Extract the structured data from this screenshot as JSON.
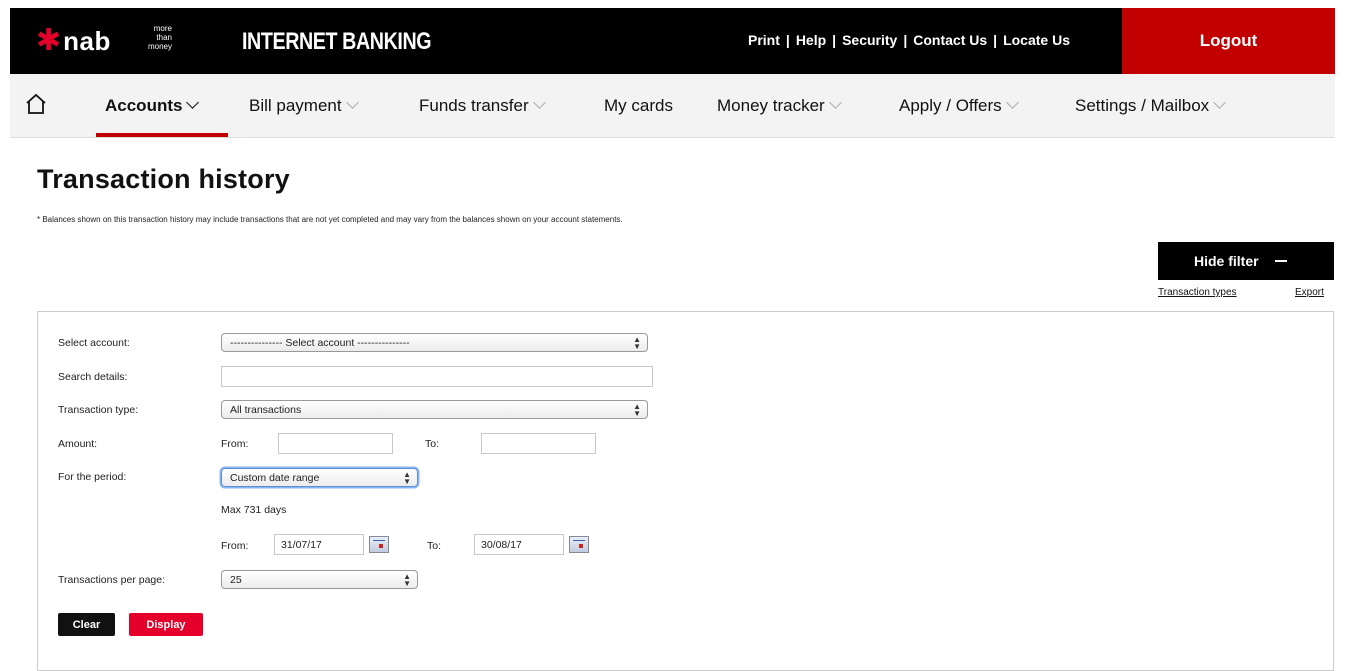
{
  "brand": {
    "logo_text": "nab",
    "tagline": [
      "more",
      "than",
      "money"
    ],
    "app_title": "INTERNET BANKING",
    "accent": "#c20000"
  },
  "utility_links": [
    "Print",
    "Help",
    "Security",
    "Contact Us",
    "Locate Us"
  ],
  "logout_label": "Logout",
  "nav": {
    "home_icon": "home-icon",
    "items": [
      {
        "label": "Accounts",
        "active": true,
        "dropdown": true
      },
      {
        "label": "Bill payment",
        "dropdown": true
      },
      {
        "label": "Funds transfer",
        "dropdown": true
      },
      {
        "label": "My cards",
        "dropdown": false
      },
      {
        "label": "Money tracker",
        "dropdown": true
      },
      {
        "label": "Apply / Offers",
        "dropdown": true
      },
      {
        "label": "Settings / Mailbox",
        "dropdown": true
      }
    ]
  },
  "page": {
    "title": "Transaction history",
    "disclaimer": "* Balances shown on this transaction history may include transactions that are not yet completed and may vary from the balances shown on your account statements.",
    "hide_filter_label": "Hide filter",
    "transaction_types_link": "Transaction types",
    "export_link": "Export"
  },
  "filter": {
    "select_account": {
      "label": "Select account:",
      "value": "--------------- Select account ---------------"
    },
    "search_details": {
      "label": "Search details:",
      "value": ""
    },
    "transaction_type": {
      "label": "Transaction type:",
      "value": "All transactions"
    },
    "amount": {
      "label": "Amount:",
      "from_label": "From:",
      "from_value": "",
      "to_label": "To:",
      "to_value": ""
    },
    "period": {
      "label": "For the period:",
      "value": "Custom date range",
      "max_note": "Max 731 days"
    },
    "dates": {
      "from_label": "From:",
      "from_value": "31/07/17",
      "to_label": "To:",
      "to_value": "30/08/17"
    },
    "per_page": {
      "label": "Transactions per page:",
      "value": "25"
    },
    "clear_label": "Clear",
    "display_label": "Display"
  }
}
